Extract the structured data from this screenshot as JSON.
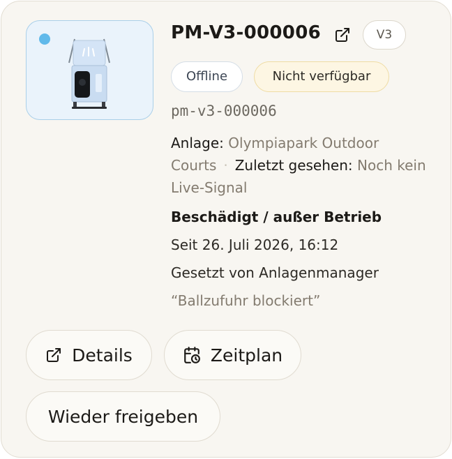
{
  "device": {
    "id": "PM-V3-000006",
    "version": "V3",
    "slug": "pm-v3-000006",
    "badges": {
      "connection": "Offline",
      "availability": "Nicht verfügbar"
    },
    "meta": {
      "facility_label": "Anlage:",
      "facility_value": "Olympiapark Outdoor Courts",
      "separator": "·",
      "last_seen_label": "Zuletzt gesehen:",
      "last_seen_value": "Noch kein Live-Signal"
    },
    "status": {
      "title": "Beschädigt / außer Betrieb",
      "since": "Seit 26. Juli 2026, 16:12",
      "set_by": "Gesetzt von Anlagenmanager",
      "note": "“Ballzufuhr blockiert”"
    }
  },
  "actions": {
    "details_label": "Details",
    "schedule_label": "Zeitplan",
    "release_label": "Wieder freigeben"
  },
  "icons": {
    "external_link": "external-link-icon",
    "calendar_clock": "calendar-clock-icon",
    "status_dot": "status-dot"
  },
  "colors": {
    "card_bg": "#f8f6f1",
    "thumb_bg": "#eaf3fb",
    "status_dot": "#60b9ea",
    "unavailable_badge_bg": "#fdf6e3",
    "muted_text": "#837b6f"
  }
}
